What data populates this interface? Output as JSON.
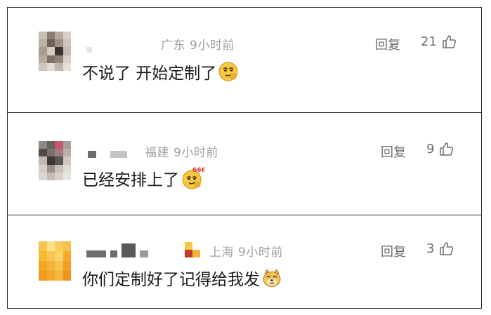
{
  "comments": [
    {
      "location": "广东",
      "time": "9小时前",
      "text": "不说了 开始定制了",
      "reply_label": "回复",
      "likes": "21",
      "emoji": "smirk-face-emoji"
    },
    {
      "location": "福建",
      "time": "9小时前",
      "text": "已经安排上了",
      "reply_label": "回复",
      "likes": "9",
      "emoji": "666-smirk-face-emoji",
      "emoji_text": "666"
    },
    {
      "location": "上海",
      "time": "9小时前",
      "text": "你们定制好了记得给我发",
      "reply_label": "回复",
      "likes": "3",
      "emoji": "doge-emoji"
    }
  ],
  "colors": {
    "meta_gray": "#a0a0a0",
    "action_gray": "#6f6f6f",
    "text_dark": "#1a1a1a",
    "border": "#2a2a2a"
  }
}
